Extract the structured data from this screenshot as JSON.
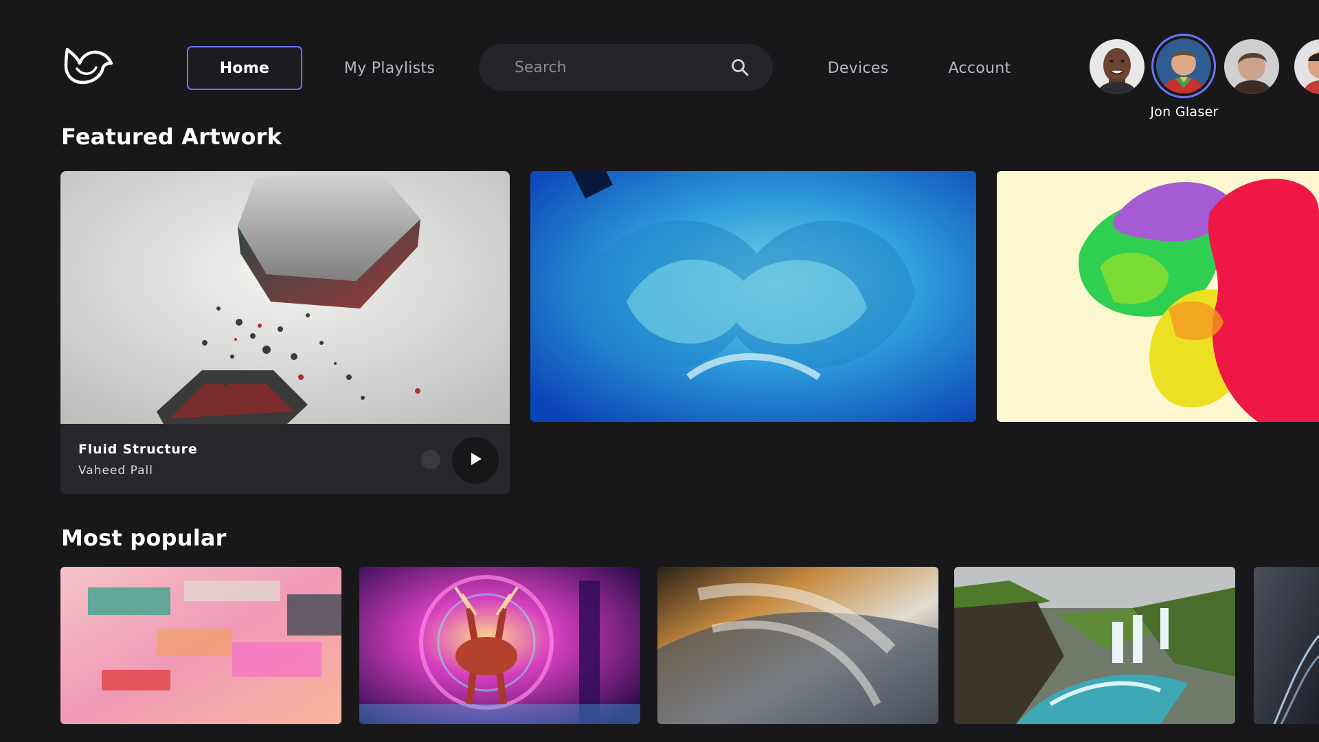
{
  "nav": {
    "home": "Home",
    "playlists": "My Playlists",
    "devices": "Devices",
    "account": "Account"
  },
  "search": {
    "placeholder": "Search"
  },
  "profiles": {
    "active_name": "Jon Glaser"
  },
  "sections": {
    "featured_title": "Featured Artwork",
    "popular_title": "Most popular"
  },
  "featured": [
    {
      "title": "Fluid Structure",
      "artist": "Vaheed Pall"
    }
  ],
  "colors": {
    "accent": "#6f75ff",
    "background": "#18181b",
    "card": "#27272c"
  },
  "icons": {
    "logo": "bird-logo-icon",
    "search": "search-icon",
    "play": "play-icon"
  }
}
